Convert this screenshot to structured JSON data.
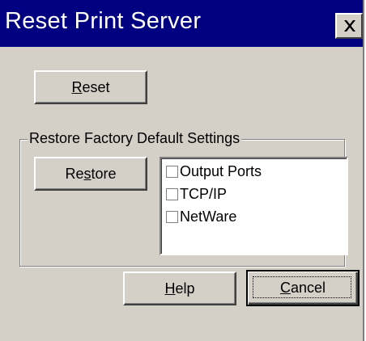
{
  "window": {
    "title": "Reset Print Server",
    "close_icon": "close-icon"
  },
  "reset_button": {
    "label_ul": "R",
    "label_rest": "eset"
  },
  "restore_group": {
    "label": "Restore Factory Default Settings",
    "restore_button": {
      "label_pre": "Re",
      "label_ul": "s",
      "label_post": "tore"
    },
    "options": [
      {
        "label": "Output Ports",
        "checked": false
      },
      {
        "label": "TCP/IP",
        "checked": false
      },
      {
        "label": "NetWare",
        "checked": false
      }
    ]
  },
  "help_button": {
    "label_ul": "H",
    "label_rest": "elp"
  },
  "cancel_button": {
    "label_ul": "C",
    "label_rest": "ancel"
  },
  "colors": {
    "titlebar": "#000080",
    "face": "#d4d0c8",
    "title_text": "#ffffff"
  }
}
